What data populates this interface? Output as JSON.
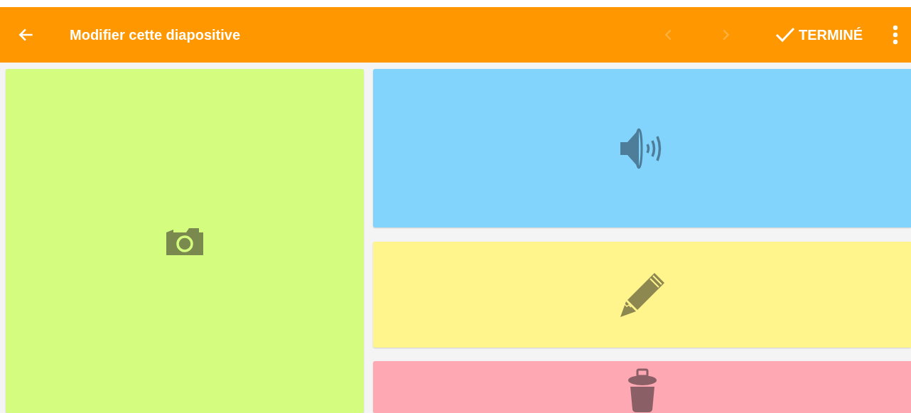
{
  "toolbar": {
    "title": "Modifier cette diapositive",
    "nav": [
      {
        "kind": "prev",
        "disabled": true
      },
      {
        "kind": "next",
        "disabled": true
      }
    ],
    "done": {
      "label": "TERMINÉ"
    }
  },
  "tiles": [
    {
      "kind": "camera",
      "color": "#d4fc7e"
    },
    {
      "kind": "sound",
      "color": "#82d4fc"
    },
    {
      "kind": "pencil",
      "color": "#fff58c"
    },
    {
      "kind": "trash",
      "color": "#fea8b3"
    }
  ]
}
